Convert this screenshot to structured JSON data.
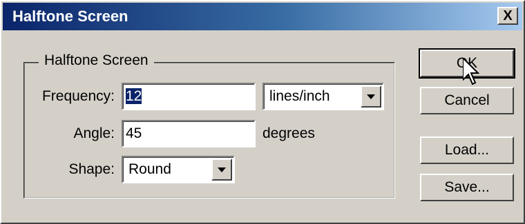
{
  "window": {
    "title": "Halftone Screen",
    "close_label": "X"
  },
  "group": {
    "legend": "Halftone Screen",
    "frequency_label": "Frequency:",
    "frequency_value": "12",
    "frequency_unit": "lines/inch",
    "angle_label": "Angle:",
    "angle_value": "45",
    "angle_unit": "degrees",
    "shape_label": "Shape:",
    "shape_value": "Round"
  },
  "buttons": {
    "ok": "OK",
    "cancel": "Cancel",
    "load": "Load...",
    "save": "Save..."
  },
  "icons": {
    "dropdown": "triangle-down-icon",
    "cursor": "arrow-cursor-icon"
  }
}
